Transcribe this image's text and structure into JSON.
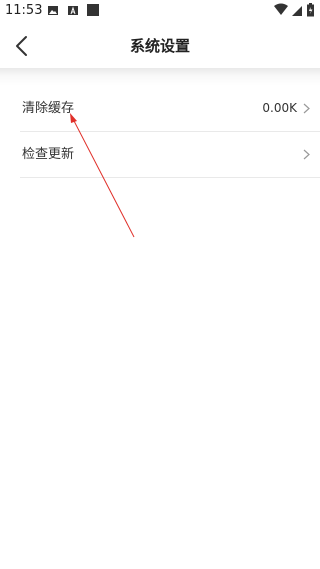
{
  "status_bar": {
    "time": "11:53",
    "icons": [
      "image-icon",
      "a-icon",
      "square-icon",
      "wifi-icon",
      "signal-icon",
      "battery-icon"
    ]
  },
  "header": {
    "title": "系统设置",
    "back_icon": "chevron-left-icon"
  },
  "settings": {
    "items": [
      {
        "label": "清除缓存",
        "value": "0.00K",
        "icon": "chevron-right-icon"
      },
      {
        "label": "检查更新",
        "value": "",
        "icon": "chevron-right-icon"
      }
    ]
  },
  "colors": {
    "background": "#ffffff",
    "divider": "#e9e9e9",
    "text": "#333333",
    "annotation": "#e0302a"
  }
}
